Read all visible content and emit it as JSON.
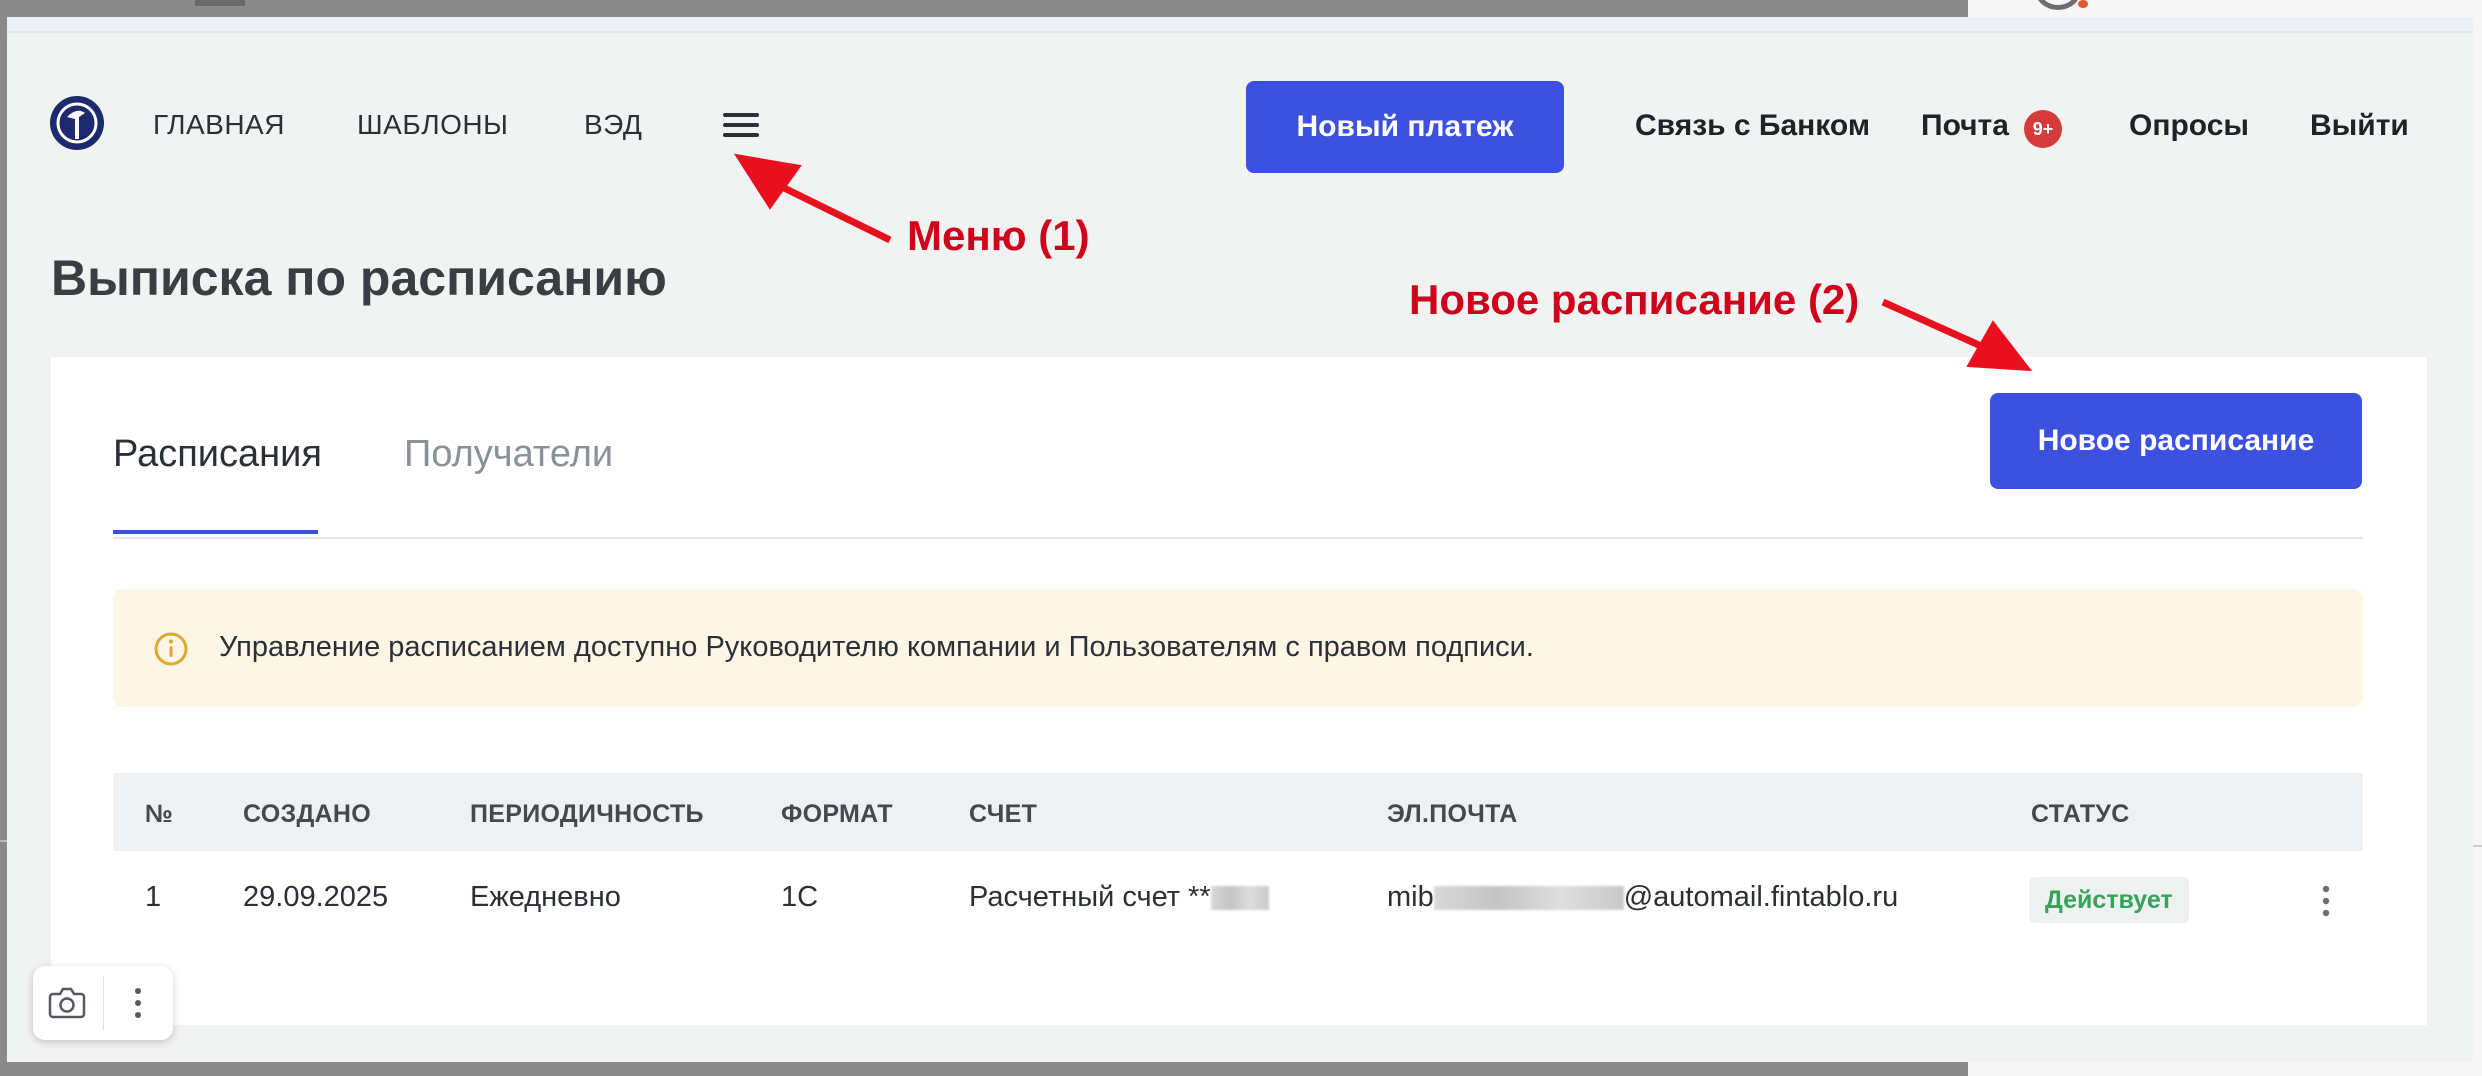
{
  "header": {
    "nav": [
      "ГЛАВНАЯ",
      "ШАБЛОНЫ",
      "ВЭД"
    ],
    "new_payment": "Новый платеж",
    "bank_contact": "Связь с Банком",
    "mail": "Почта",
    "mail_badge": "9+",
    "surveys": "Опросы",
    "logout": "Выйти"
  },
  "page": {
    "title": "Выписка по расписанию",
    "tabs": [
      {
        "label": "Расписания",
        "active": true
      },
      {
        "label": "Получатели",
        "active": false
      }
    ],
    "new_schedule": "Новое расписание",
    "notice": "Управление расписанием доступно Руководителю компании и Пользователям с правом подписи."
  },
  "table": {
    "columns": [
      "№",
      "СОЗДАНО",
      "ПЕРИОДИЧНОСТЬ",
      "ФОРМАТ",
      "СЧЕТ",
      "ЭЛ.ПОЧТА",
      "СТАТУС"
    ],
    "rows": [
      {
        "num": "1",
        "created": "29.09.2025",
        "period": "Ежедневно",
        "format": "1С",
        "account": "Расчетный счет **",
        "email_prefix": "mib",
        "email_suffix": "@automail.fintablo.ru",
        "status": "Действует"
      }
    ]
  },
  "annotations": {
    "menu": "Меню (1)",
    "new_schedule": "Новое расписание (2)",
    "color": "#d0021b"
  },
  "colors": {
    "accent": "#3d51e1",
    "status_green": "#35a35a",
    "badge_red": "#d63a3a"
  }
}
